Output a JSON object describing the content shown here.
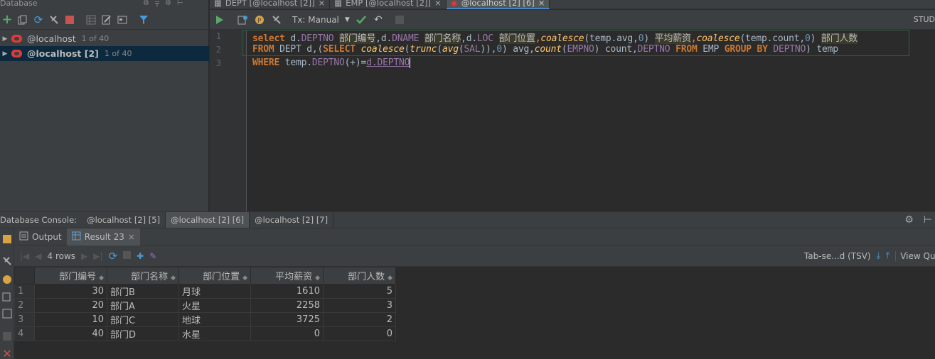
{
  "left_panel": {
    "title": "Database",
    "tree": [
      {
        "name": "@localhost",
        "count": "1 of 40"
      },
      {
        "name": "@localhost [2]",
        "count": "1 of 40"
      }
    ]
  },
  "editor_tabs": [
    {
      "label": "DEPT [@localhost [2]]"
    },
    {
      "label": "EMP [@localhost [2]]"
    },
    {
      "label": "@localhost [2] [6]"
    }
  ],
  "editor_toolbar": {
    "tx_mode": "Tx: Manual",
    "right_label": "STUD"
  },
  "editor": {
    "line_numbers": [
      "1",
      "2",
      "3"
    ],
    "line1": {
      "t1": "select",
      "t2": " d.",
      "t3": "DEPTNO",
      "t4": " ",
      "t5": "部门编号",
      "t6": ",d.",
      "t7": "DNAME",
      "t8": " ",
      "t9": "部门名称",
      "t10": ",d.",
      "t11": "LOC",
      "t12": " ",
      "t13": "部门位置",
      "t14": ",",
      "t15": "coalesce",
      "t16": "(temp.avg,",
      "t17": "0",
      "t18": ") ",
      "t19": "平均薪资",
      "t20": ",",
      "t21": "coalesce",
      "t22": "(temp.count,",
      "t23": "0",
      "t24": ") ",
      "t25": "部门人数"
    },
    "line2": {
      "t1": "FROM",
      "t2": " DEPT d,(",
      "t3": "SELECT",
      "t4": " ",
      "t5": "coalesce",
      "t6": "(",
      "t7": "trunc",
      "t8": "(",
      "t9": "avg",
      "t10": "(",
      "t11": "SAL",
      "t12": ")),",
      "t13": "0",
      "t14": ") avg,",
      "t15": "count",
      "t16": "(",
      "t17": "EMPNO",
      "t18": ") count,",
      "t19": "DEPTNO",
      "t20": " ",
      "t21": "FROM",
      "t22": " EMP ",
      "t23": "GROUP BY",
      "t24": " ",
      "t25": "DEPTNO",
      "t26": ") temp"
    },
    "line3": {
      "t1": "WHERE",
      "t2": " temp.",
      "t3": "DEPTNO",
      "t4": "(+)=",
      "t5": "d.DEPTNO"
    }
  },
  "console_bar": {
    "label": "Database Console:",
    "tabs": [
      "@localhost [2] [5]",
      "@localhost [2] [6]",
      "@localhost [2] [7]"
    ]
  },
  "result_tabs": [
    {
      "label": "Output"
    },
    {
      "label": "Result 23"
    }
  ],
  "result_toolbar": {
    "rows": "4 rows",
    "export_format": "Tab-se...d (TSV)",
    "view_query": "View Query"
  },
  "table": {
    "columns": [
      "部门编号",
      "部门名称",
      "部门位置",
      "平均薪资",
      "部门人数"
    ],
    "rows": [
      {
        "num": "1",
        "cells": [
          "30",
          "部门B",
          "月球",
          "1610",
          "5"
        ]
      },
      {
        "num": "2",
        "cells": [
          "20",
          "部门A",
          "火星",
          "2258",
          "3"
        ]
      },
      {
        "num": "3",
        "cells": [
          "10",
          "部门C",
          "地球",
          "3725",
          "2"
        ]
      },
      {
        "num": "4",
        "cells": [
          "40",
          "部门D",
          "水星",
          "0",
          "0"
        ]
      }
    ]
  }
}
